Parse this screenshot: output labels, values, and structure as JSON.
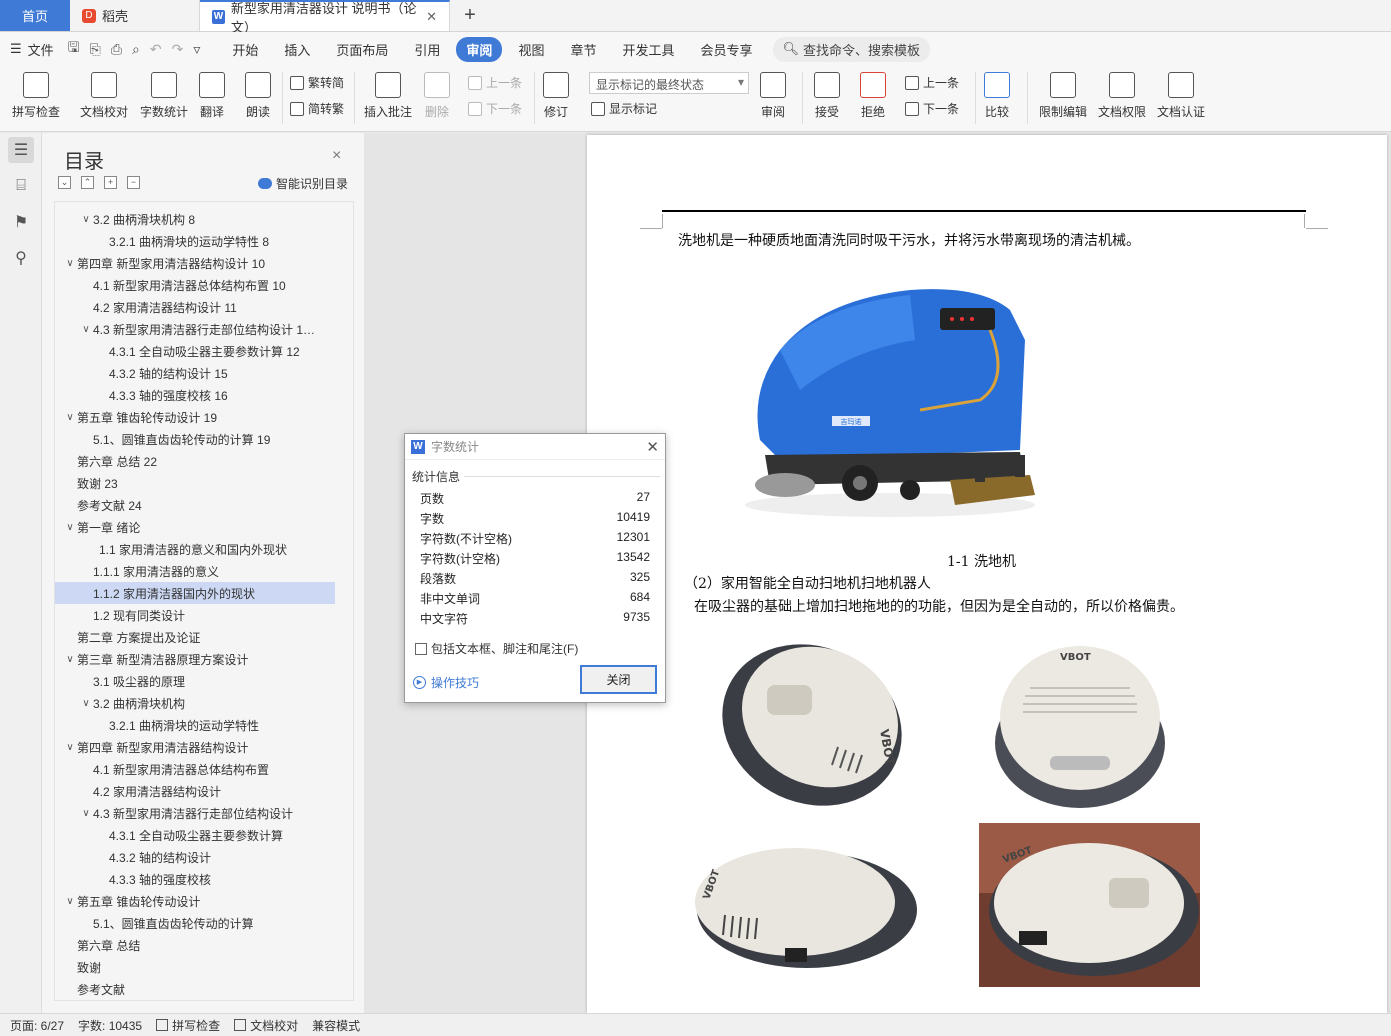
{
  "tabs": {
    "home": "首页",
    "docer": "稻壳",
    "document": "新型家用清洁器设计 说明书（论文）",
    "close_symbol": "✕",
    "plus_symbol": "+"
  },
  "menu": {
    "file": "文件",
    "items": [
      "开始",
      "插入",
      "页面布局",
      "引用",
      "审阅",
      "视图",
      "章节",
      "开发工具",
      "会员专享"
    ],
    "active_index": 4,
    "search": "查找命令、搜索模板"
  },
  "ribbon": {
    "spellcheck": "拼写检查",
    "doc_proof": "文档校对",
    "word_count": "字数统计",
    "translate": "翻译",
    "read_aloud": "朗读",
    "to_traditional": "繁转简",
    "to_simplified": "简转繁",
    "insert_comment": "插入批注",
    "delete": "删除",
    "prev": "上一条",
    "next": "下一条",
    "track_changes": "修订",
    "markup_state": "显示标记的最终状态",
    "show_markup": "显示标记",
    "review": "审阅",
    "accept": "接受",
    "reject": "拒绝",
    "prev2": "上一条",
    "next2": "下一条",
    "compare": "比较",
    "restrict_edit": "限制编辑",
    "doc_permission": "文档权限",
    "doc_cert": "文档认证"
  },
  "toc": {
    "title": "目录",
    "close": "×",
    "smart": "智能识别目录",
    "items": [
      {
        "text": "3.2  曲柄滑块机构  8",
        "level": 2,
        "arrow": true
      },
      {
        "text": "3.2.1 曲柄滑块的运动学特性  8",
        "level": 3,
        "arrow": false
      },
      {
        "text": "第四章  新型家用清洁器结构设计  10",
        "level": 1,
        "arrow": true
      },
      {
        "text": "4.1  新型家用清洁器总体结构布置  10",
        "level": 2,
        "arrow": false
      },
      {
        "text": "4.2 家用清洁器结构设计  11",
        "level": 2,
        "arrow": false
      },
      {
        "text": "4.3 新型家用清洁器行走部位结构设计  1…",
        "level": 2,
        "arrow": true
      },
      {
        "text": "4.3.1 全自动吸尘器主要参数计算  12",
        "level": 3,
        "arrow": false
      },
      {
        "text": "4.3.2 轴的结构设计  15",
        "level": 3,
        "arrow": false
      },
      {
        "text": "4.3.3 轴的强度校核  16",
        "level": 3,
        "arrow": false
      },
      {
        "text": "第五章  锥齿轮传动设计  19",
        "level": 1,
        "arrow": true
      },
      {
        "text": "5.1、圆锥直齿齿轮传动的计算  19",
        "level": 2,
        "arrow": false
      },
      {
        "text": "第六章  总结  22",
        "level": 1,
        "arrow": false
      },
      {
        "text": "致谢  23",
        "level": 1,
        "arrow": false
      },
      {
        "text": "参考文献  24",
        "level": 1,
        "arrow": false
      },
      {
        "text": "第一章  绪论",
        "level": 1,
        "arrow": true
      },
      {
        "text": "1.1 家用清洁器的意义和国内外现状",
        "level": 2.5,
        "arrow": false
      },
      {
        "text": "1.1.1 家用清洁器的意义",
        "level": 2,
        "arrow": false
      },
      {
        "text": "1.1.2 家用清洁器国内外的现状",
        "level": 2,
        "arrow": false,
        "selected": true
      },
      {
        "text": "1.2 现有同类设计",
        "level": 2,
        "arrow": false
      },
      {
        "text": "第二章  方案提出及论证",
        "level": 1,
        "arrow": false
      },
      {
        "text": "第三章  新型清洁器原理方案设计",
        "level": 1,
        "arrow": true
      },
      {
        "text": "3.1 吸尘器的原理",
        "level": 2,
        "arrow": false
      },
      {
        "text": "3.2  曲柄滑块机构",
        "level": 2,
        "arrow": true
      },
      {
        "text": "3.2.1 曲柄滑块的运动学特性",
        "level": 3,
        "arrow": false
      },
      {
        "text": "第四章  新型家用清洁器结构设计",
        "level": 1,
        "arrow": true
      },
      {
        "text": "4.1  新型家用清洁器总体结构布置",
        "level": 2,
        "arrow": false
      },
      {
        "text": "4.2 家用清洁器结构设计",
        "level": 2,
        "arrow": false
      },
      {
        "text": "4.3 新型家用清洁器行走部位结构设计",
        "level": 2,
        "arrow": true
      },
      {
        "text": "4.3.1 全自动吸尘器主要参数计算",
        "level": 3,
        "arrow": false
      },
      {
        "text": "4.3.2 轴的结构设计",
        "level": 3,
        "arrow": false
      },
      {
        "text": "4.3.3 轴的强度校核",
        "level": 3,
        "arrow": false
      },
      {
        "text": "第五章  锥齿轮传动设计",
        "level": 1,
        "arrow": true
      },
      {
        "text": "5.1、圆锥直齿齿轮传动的计算",
        "level": 2,
        "arrow": false
      },
      {
        "text": "第六章  总结",
        "level": 1,
        "arrow": false
      },
      {
        "text": "致谢",
        "level": 1,
        "arrow": false
      },
      {
        "text": "参考文献",
        "level": 1,
        "arrow": false
      }
    ]
  },
  "document": {
    "line1": "洗地机是一种硬质地面清洗同时吸干污水，并将污水带离现场的清洁机械。",
    "caption1": "1-1 洗地机",
    "line2": "（2）家用智能全自动扫地机扫地机器人",
    "line3": "在吸尘器的基础上增加扫地拖地的的功能，但因为是全自动的，所以价格偏贵。",
    "robot_brand": "VBOT",
    "scrubber_label": "吉玛诺"
  },
  "dialog": {
    "title": "字数统计",
    "section": "统计信息",
    "stats": [
      {
        "label": "页数",
        "value": "27"
      },
      {
        "label": "字数",
        "value": "10419"
      },
      {
        "label": "字符数(不计空格)",
        "value": "12301"
      },
      {
        "label": "字符数(计空格)",
        "value": "13542"
      },
      {
        "label": "段落数",
        "value": "325"
      },
      {
        "label": "非中文单词",
        "value": "684"
      },
      {
        "label": "中文字符",
        "value": "9735"
      }
    ],
    "checkbox": "包括文本框、脚注和尾注(F)",
    "tips": "操作技巧",
    "close_button": "关闭"
  },
  "status": {
    "page": "页面: 6/27",
    "words": "字数: 10435",
    "spell": "拼写检查",
    "proof": "文档校对",
    "compat": "兼容模式"
  }
}
